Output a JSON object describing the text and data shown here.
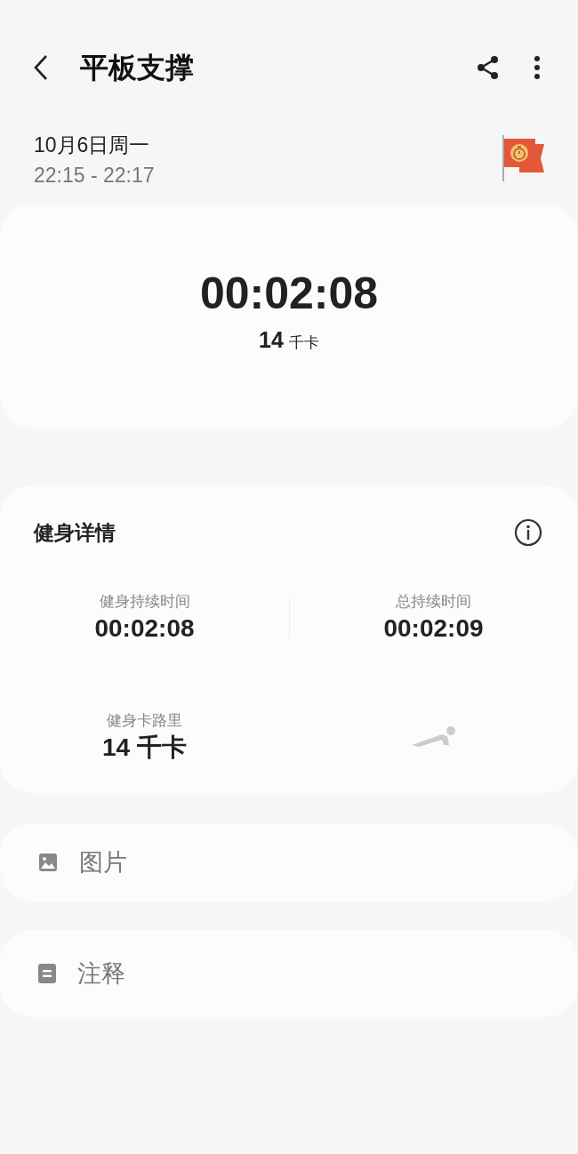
{
  "header": {
    "title": "平板支撑"
  },
  "session": {
    "date": "10月6日周一",
    "time_range": "22:15 - 22:17"
  },
  "summary": {
    "duration": "00:02:08",
    "calories": "14",
    "calories_unit": "千卡"
  },
  "details": {
    "title": "健身详情",
    "stats": [
      {
        "kind": "metric",
        "label": "健身持续时间",
        "value": "00:02:08"
      },
      {
        "kind": "metric",
        "label": "总持续时间",
        "value": "00:02:09"
      },
      {
        "kind": "metric",
        "label": "健身卡路里",
        "value": "14 千卡"
      },
      {
        "kind": "exercise-icon"
      }
    ]
  },
  "attachments": [
    {
      "kind": "image",
      "label": "图片"
    },
    {
      "kind": "note",
      "label": "注释"
    }
  ]
}
